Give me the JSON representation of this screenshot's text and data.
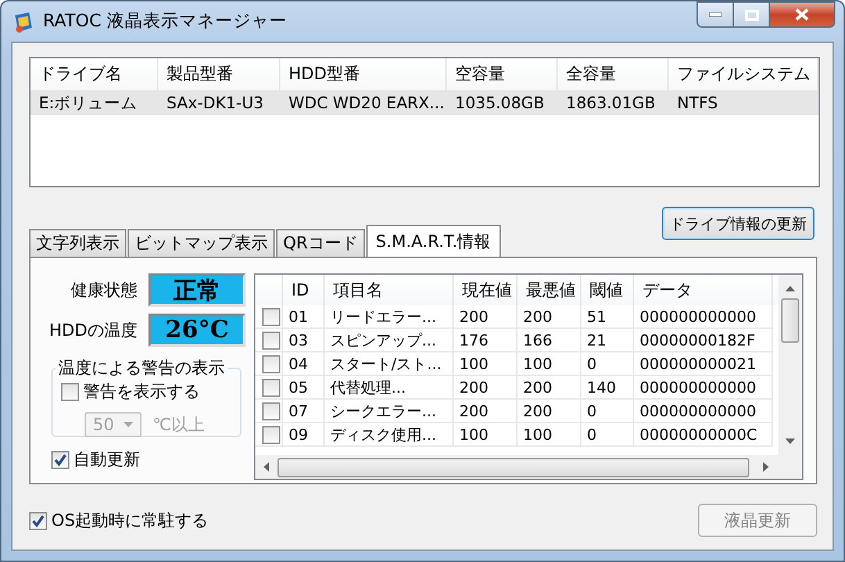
{
  "window": {
    "title": "RATOC 液晶表示マネージャー"
  },
  "drives": {
    "columns": [
      "ドライブ名",
      "製品型番",
      "HDD型番",
      "空容量",
      "全容量",
      "ファイルシステム"
    ],
    "rows": [
      {
        "selected": true,
        "cells": [
          "E:ボリューム",
          "SAx-DK1-U3",
          "WDC WD20 EARX...",
          "1035.08GB",
          "1863.01GB",
          "NTFS"
        ]
      }
    ]
  },
  "refresh_button": {
    "label": "ドライブ情報の更新"
  },
  "tabs": [
    {
      "label": "文字列表示",
      "selected": false
    },
    {
      "label": "ビットマップ表示",
      "selected": false
    },
    {
      "label": "QRコード",
      "selected": false
    },
    {
      "label": "S.M.A.R.T.情報",
      "selected": true
    }
  ],
  "health": {
    "label": "健康状態",
    "value": "正常"
  },
  "temperature": {
    "label": "HDDの温度",
    "value": "26°C"
  },
  "warning_group": {
    "title": "温度による警告の表示",
    "show_warning": {
      "label": "警告を表示する",
      "checked": false
    },
    "threshold": {
      "value": "50",
      "disabled": true
    },
    "unit": {
      "label": "℃以上",
      "disabled": true
    }
  },
  "auto_update": {
    "label": "自動更新",
    "checked": true
  },
  "smart": {
    "columns": [
      "ID",
      "項目名",
      "現在値",
      "最悪値",
      "閾値",
      "データ"
    ],
    "rows": [
      {
        "checked": false,
        "cells": [
          "01",
          "リードエラー...",
          "200",
          "200",
          "51",
          "000000000000"
        ]
      },
      {
        "checked": false,
        "cells": [
          "03",
          "スピンアップ...",
          "176",
          "166",
          "21",
          "00000000182F"
        ]
      },
      {
        "checked": false,
        "cells": [
          "04",
          "スタート/スト...",
          "100",
          "100",
          "0",
          "000000000021"
        ]
      },
      {
        "checked": false,
        "cells": [
          "05",
          "代替処理...",
          "200",
          "200",
          "140",
          "000000000000"
        ]
      },
      {
        "checked": false,
        "cells": [
          "07",
          "シークエラー...",
          "200",
          "200",
          "0",
          "000000000000"
        ]
      },
      {
        "checked": false,
        "cells": [
          "09",
          "ディスク使用...",
          "100",
          "100",
          "0",
          "00000000000C"
        ]
      }
    ]
  },
  "startup": {
    "label": "OS起動時に常駐する",
    "checked": true
  },
  "lcd_button": {
    "label": "液晶更新",
    "disabled": true
  }
}
